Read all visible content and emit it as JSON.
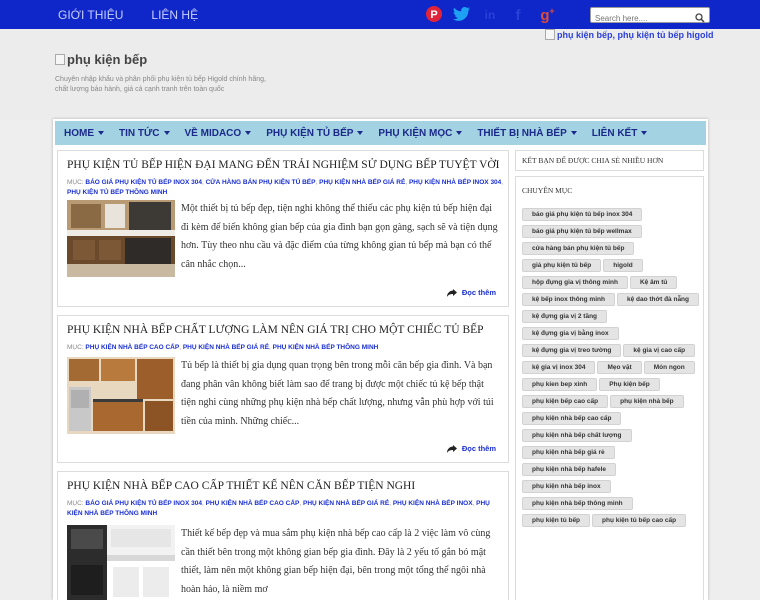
{
  "topnav": [
    {
      "label": "GIỚI THIỆU"
    },
    {
      "label": "LIÊN HỆ"
    }
  ],
  "search": {
    "placeholder": "Search here...."
  },
  "header": {
    "logo_alt": "phụ kiện bếp",
    "tagline": "Chuyên nhập khẩu và phân phối phụ kiện tủ bếp Higold chính hãng, chất lượng bảo hành, giá cả cạnh tranh trên toàn quốc",
    "banner_alt": "phụ kiện bếp, phụ kiện tủ bếp higold"
  },
  "menu": [
    {
      "label": "HOME"
    },
    {
      "label": "TIN TỨC"
    },
    {
      "label": "VỀ MIDACO"
    },
    {
      "label": "PHỤ KIỆN TỦ BẾP"
    },
    {
      "label": "PHỤ KIỆN MỌC"
    },
    {
      "label": "THIẾT BỊ NHÀ BẾP"
    },
    {
      "label": "LIÊN KẾT"
    }
  ],
  "meta_prefix": "MỤC:",
  "readmore": "Đọc thêm",
  "posts": [
    {
      "title": "PHỤ KIỆN TỦ BẾP HIỆN ĐẠI MANG ĐẾN TRẢI NGHIỆM SỬ DỤNG BẾP TUYỆT VỜI",
      "tags": [
        "BÁO GIÁ PHỤ KIỆN TỦ BẾP INOX 304",
        "CỬA HÀNG BÁN PHỤ KIỆN TỦ BẾP",
        "PHỤ KIỆN NHÀ BẾP GIÁ RẺ",
        "PHỤ KIỆN NHÀ BẾP INOX 304",
        "PHỤ KIỆN TỦ BẾP THÔNG MINH"
      ],
      "excerpt": "Một thiết bị tủ bếp đẹp, tiện nghi không thể thiếu các phụ kiện tủ bếp hiện đại đi kèm để biến không gian bếp của gia đình bạn gọn gàng, sạch sẽ và tiện dụng hơn. Tùy theo nhu cầu và đặc điểm của từng không gian tủ bếp mà bạn có thể cân nhắc chọn..."
    },
    {
      "title": "PHỤ KIỆN NHÀ BẾP CHẤT LƯỢNG LÀM NÊN GIÁ TRỊ CHO MỘT CHIẾC TỦ BẾP",
      "tags": [
        "PHỤ KIỆN NHÀ BẾP CAO CẤP",
        "PHỤ KIỆN NHÀ BẾP GIÁ RẺ",
        "PHỤ KIỆN NHÀ BẾP THÔNG MINH"
      ],
      "excerpt": "Tủ bếp là thiết bị gia dụng quan trọng bên trong mỗi căn bếp gia đình. Và bạn đang phân vân không biết làm sao để trang bị được một chiếc tủ kệ bếp thật tiện nghi cùng những phụ kiện nhà bếp chất lượng, nhưng vẫn phù hợp với túi tiền của mình. Những chiếc..."
    },
    {
      "title": "PHỤ KIỆN NHÀ BẾP CAO CẤP THIẾT KẾ NÊN CĂN BẾP TIỆN NGHI",
      "tags": [
        "BÁO GIÁ PHỤ KIỆN TỦ BẾP INOX 304",
        "PHỤ KIỆN NHÀ BẾP CAO CẤP",
        "PHỤ KIỆN NHÀ BẾP GIÁ RẺ",
        "PHỤ KIỆN NHÀ BẾP INOX",
        "PHỤ KIỆN NHÀ BẾP THÔNG MINH"
      ],
      "excerpt": "Thiết kế bếp đẹp và mua sắm phụ kiện nhà bếp cao cấp là 2 việc làm vô cùng cần thiết bên trong một không gian bếp gia đình. Đây là 2 yếu tố gắn bó mật thiết, làm nên một không gian bếp hiện đại, bên trong một tổng thể ngôi nhà hoàn hảo, là niềm mơ"
    }
  ],
  "sidebar": {
    "share_title": "KẾT BẠN ĐỂ ĐƯỢC CHIA SẺ NHIỀU HƠN",
    "category_title": "CHUYÊN MỤC",
    "categories": [
      "báo giá phụ kiện tủ bếp inox 304",
      "báo giá phụ kiện tủ bếp wellmax",
      "cửa hàng bán phụ kiện tủ bếp",
      "giá phụ kiện tủ bếp",
      "higold",
      "hộp đựng gia vị thông minh",
      "Kệ âm tủ",
      "kệ bếp inox thông minh",
      "kệ dao thớt đà nẵng",
      "kệ đựng gia vị 2 tầng",
      "kệ đựng gia vị bằng inox",
      "kệ đựng gia vị treo tường",
      "kệ gia vị cao cấp",
      "kệ gia vị inox 304",
      "Mẹo vặt",
      "Món ngon",
      "phụ kien bep xinh",
      "Phụ kiện bếp",
      "phụ kiện bếp cao cấp",
      "phụ kiện nhà bếp",
      "phụ kiện nhà bếp cao cấp",
      "phụ kiện nhà bếp chất lượng",
      "phụ kiện nhà bếp giá rẻ",
      "phụ kiện nhà bếp hafele",
      "phụ kiện nhà bếp inox",
      "phụ kiện nhà bếp thông minh",
      "phụ kiện tủ bếp",
      "phụ kiện tủ bếp cao cấp"
    ]
  },
  "colors": {
    "topbar": "#0f26c9",
    "menu": "#a3d2e3",
    "link": "#1a2fd0"
  }
}
